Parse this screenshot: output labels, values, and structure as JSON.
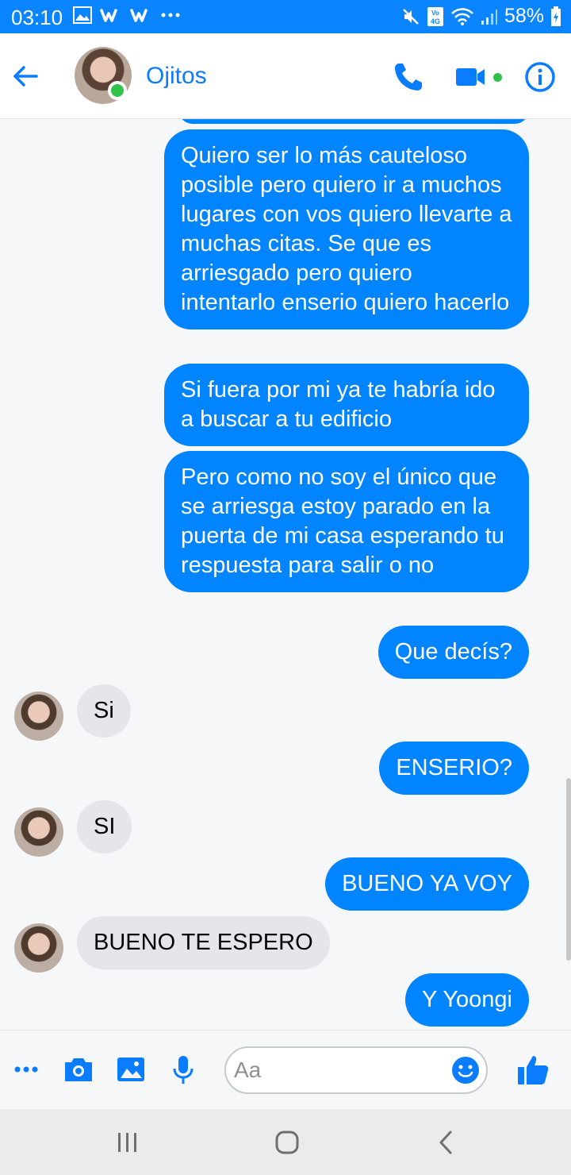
{
  "status_bar": {
    "time": "03:10",
    "battery": "58%",
    "network": "VoLTE 4G"
  },
  "header": {
    "contact_name": "Ojitos",
    "online": true,
    "accent": "#0a7cff"
  },
  "messages": [
    {
      "from": "me",
      "text": "Quiero ser lo más cauteloso posible pero quiero ir a muchos lugares con vos quiero llevarte a muchas citas. Se que es arriesgado pero quiero intentarlo enserio quiero hacerlo"
    },
    {
      "from": "me",
      "text": "Si fuera por mi ya te habría ido a buscar a tu edificio"
    },
    {
      "from": "me",
      "text": "Pero como no soy el único que se arriesga estoy parado en la puerta de mi casa esperando tu respuesta para salir o no"
    },
    {
      "from": "me",
      "text": "Que decís?"
    },
    {
      "from": "them",
      "text": "Si"
    },
    {
      "from": "me",
      "text": "ENSERIO?"
    },
    {
      "from": "them",
      "text": "SI"
    },
    {
      "from": "me",
      "text": "BUENO YA VOY"
    },
    {
      "from": "them",
      "text": "BUENO TE ESPERO"
    },
    {
      "from": "me",
      "text": "Y Yoongi"
    }
  ],
  "composer": {
    "placeholder": "Aa"
  },
  "colors": {
    "sent_bubble": "#0084ff",
    "received_bubble": "#e4e6eb",
    "online_dot": "#31c24a",
    "status_bar": "#0a84ff"
  }
}
